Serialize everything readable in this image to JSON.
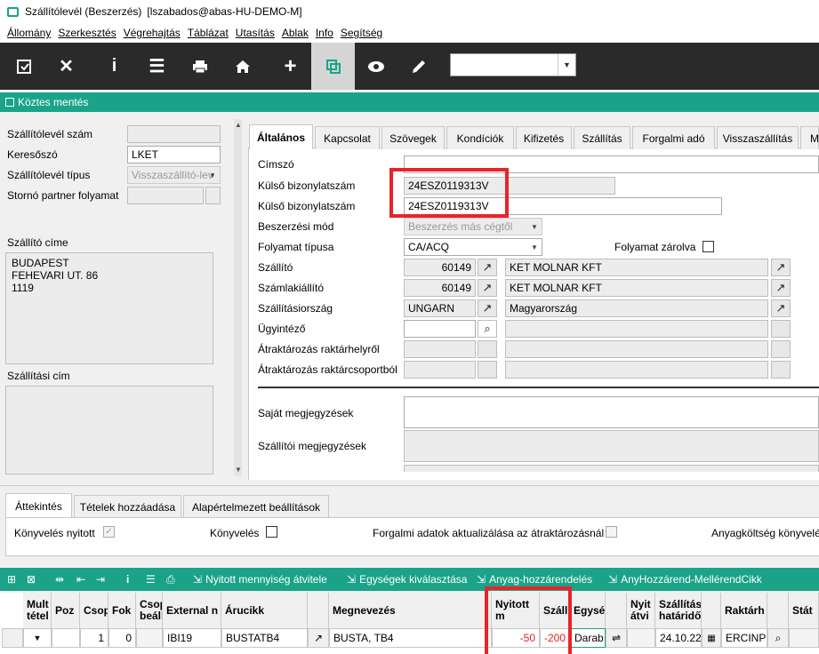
{
  "window": {
    "title": "Szállítólevél (Beszerzés)",
    "user": "[lszabados@abas-HU-DEMO-M]"
  },
  "menu": [
    "Állomány",
    "Szerkesztés",
    "Végrehajtás",
    "Táblázat",
    "Utasítás",
    "Ablak",
    "Info",
    "Segítség"
  ],
  "toolbar": {
    "icons": [
      "save-icon",
      "close-icon",
      "info-icon",
      "list-icon",
      "print-icon",
      "home-icon",
      "plus-icon",
      "copy-icon",
      "eye-icon",
      "pencil-icon"
    ],
    "select_value": ""
  },
  "action": {
    "label": "Köztes mentés"
  },
  "left": {
    "doc_no_label": "Szállítólevél szám",
    "doc_no": "",
    "search_label": "Keresőszó",
    "search": "LKET",
    "type_label": "Szállítólevél típus",
    "type": "Visszaszállító-lev",
    "storno_label": "Stornó partner folyamat",
    "storno": "",
    "addr_label": "Szállító címe",
    "addr": [
      "BUDAPEST",
      "FEHEVARI UT. 86",
      "1119"
    ],
    "ship_label": "Szállítási cím"
  },
  "tabs": [
    "Általános",
    "Kapcsolat",
    "Szövegek",
    "Kondíciók",
    "Kifizetés",
    "Szállítás",
    "Forgalmi adó",
    "Visszaszállítás",
    "M"
  ],
  "form": {
    "cimszo_label": "Címszó",
    "cimszo": "",
    "ext1_label": "Külső bizonylatszám",
    "ext1": "24ESZ0119313V",
    "ext2_label": "Külső bizonylatszám",
    "ext2": "24ESZ0119313V",
    "mode_label": "Beszerzési mód",
    "mode": "Beszerzés más cégtől",
    "flow_label": "Folyamat típusa",
    "flow": "CA/ACQ",
    "locked_label": "Folyamat zárolva",
    "supplier_label": "Szállító",
    "supplier_no": "60149",
    "supplier_name": "KET MOLNAR KFT",
    "invoicer_label": "Számlakiállító",
    "invoicer_no": "60149",
    "invoicer_name": "KET MOLNAR KFT",
    "country_label": "Szállításiország",
    "country_code": "UNGARN",
    "country_name": "Magyarország",
    "agent_label": "Ügyintéző",
    "wh_loc_label": "Átraktározás raktárhelyről",
    "wh_grp_label": "Átraktározás raktárcsoportból",
    "own_note_label": "Saját megjegyzések",
    "sup_note_label": "Szállítói megjegyzések"
  },
  "bottom_tabs": [
    "Áttekintés",
    "Tételek hozzáadása",
    "Alapértelmezett beállítások"
  ],
  "status": {
    "posting_open": "Könyvelés nyitott",
    "posting": "Könyvelés",
    "tax_update": "Forgalmi adatok aktualizálása az átraktározásnál",
    "material_cost": "Anyagköltség könyvelés"
  },
  "grid_toolbar": [
    "Nyitott mennyiség átvitele",
    "Egységek kiválasztása",
    "Anyag-hozzárendelés",
    "AnyHozzárend-MellérendCikk"
  ],
  "grid": {
    "headers": [
      "Mult tétel",
      "Poz",
      "Csop",
      "Fok",
      "Csop beáll",
      "External n",
      "Árucikk",
      "Megnevezés",
      "Nyitott m",
      "Száll",
      "Egység",
      "Nyit átvi",
      "Szállítási határidő",
      "Raktárh",
      "Stát"
    ],
    "row": {
      "group": "1",
      "level": "0",
      "external": "IBI19",
      "item": "BUSTATB4",
      "name": "BUSTA, TB4",
      "open": "-50",
      "ship": "-200",
      "unit": "Darab",
      "date": "24.10.22",
      "warehouse": "ERCINP"
    }
  },
  "colors": {
    "accent": "#1aa388",
    "toolbar": "#2a2a2a",
    "highlight": "#e8232b",
    "negative": "#e02020"
  }
}
